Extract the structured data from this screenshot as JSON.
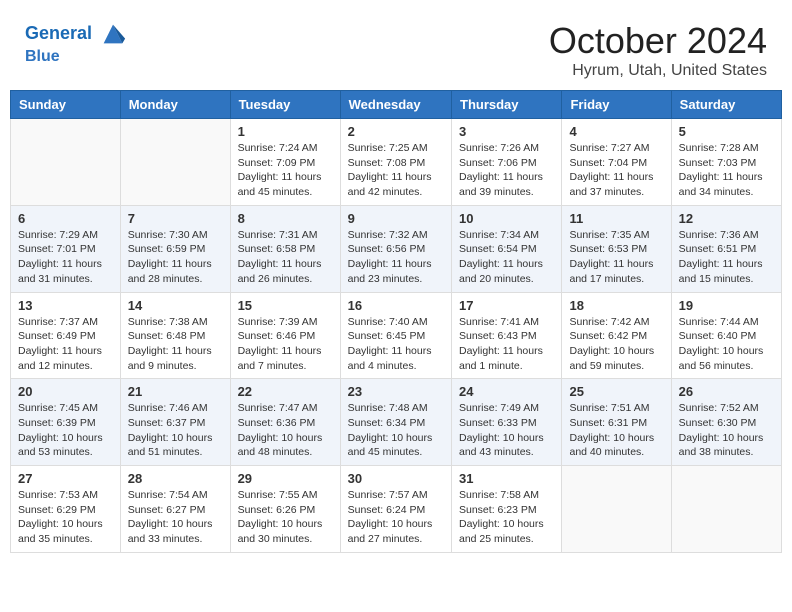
{
  "header": {
    "logo_line1": "General",
    "logo_line2": "Blue",
    "month": "October 2024",
    "location": "Hyrum, Utah, United States"
  },
  "days_of_week": [
    "Sunday",
    "Monday",
    "Tuesday",
    "Wednesday",
    "Thursday",
    "Friday",
    "Saturday"
  ],
  "weeks": [
    [
      {
        "day": "",
        "info": ""
      },
      {
        "day": "",
        "info": ""
      },
      {
        "day": "1",
        "sunrise": "Sunrise: 7:24 AM",
        "sunset": "Sunset: 7:09 PM",
        "daylight": "Daylight: 11 hours and 45 minutes."
      },
      {
        "day": "2",
        "sunrise": "Sunrise: 7:25 AM",
        "sunset": "Sunset: 7:08 PM",
        "daylight": "Daylight: 11 hours and 42 minutes."
      },
      {
        "day": "3",
        "sunrise": "Sunrise: 7:26 AM",
        "sunset": "Sunset: 7:06 PM",
        "daylight": "Daylight: 11 hours and 39 minutes."
      },
      {
        "day": "4",
        "sunrise": "Sunrise: 7:27 AM",
        "sunset": "Sunset: 7:04 PM",
        "daylight": "Daylight: 11 hours and 37 minutes."
      },
      {
        "day": "5",
        "sunrise": "Sunrise: 7:28 AM",
        "sunset": "Sunset: 7:03 PM",
        "daylight": "Daylight: 11 hours and 34 minutes."
      }
    ],
    [
      {
        "day": "6",
        "sunrise": "Sunrise: 7:29 AM",
        "sunset": "Sunset: 7:01 PM",
        "daylight": "Daylight: 11 hours and 31 minutes."
      },
      {
        "day": "7",
        "sunrise": "Sunrise: 7:30 AM",
        "sunset": "Sunset: 6:59 PM",
        "daylight": "Daylight: 11 hours and 28 minutes."
      },
      {
        "day": "8",
        "sunrise": "Sunrise: 7:31 AM",
        "sunset": "Sunset: 6:58 PM",
        "daylight": "Daylight: 11 hours and 26 minutes."
      },
      {
        "day": "9",
        "sunrise": "Sunrise: 7:32 AM",
        "sunset": "Sunset: 6:56 PM",
        "daylight": "Daylight: 11 hours and 23 minutes."
      },
      {
        "day": "10",
        "sunrise": "Sunrise: 7:34 AM",
        "sunset": "Sunset: 6:54 PM",
        "daylight": "Daylight: 11 hours and 20 minutes."
      },
      {
        "day": "11",
        "sunrise": "Sunrise: 7:35 AM",
        "sunset": "Sunset: 6:53 PM",
        "daylight": "Daylight: 11 hours and 17 minutes."
      },
      {
        "day": "12",
        "sunrise": "Sunrise: 7:36 AM",
        "sunset": "Sunset: 6:51 PM",
        "daylight": "Daylight: 11 hours and 15 minutes."
      }
    ],
    [
      {
        "day": "13",
        "sunrise": "Sunrise: 7:37 AM",
        "sunset": "Sunset: 6:49 PM",
        "daylight": "Daylight: 11 hours and 12 minutes."
      },
      {
        "day": "14",
        "sunrise": "Sunrise: 7:38 AM",
        "sunset": "Sunset: 6:48 PM",
        "daylight": "Daylight: 11 hours and 9 minutes."
      },
      {
        "day": "15",
        "sunrise": "Sunrise: 7:39 AM",
        "sunset": "Sunset: 6:46 PM",
        "daylight": "Daylight: 11 hours and 7 minutes."
      },
      {
        "day": "16",
        "sunrise": "Sunrise: 7:40 AM",
        "sunset": "Sunset: 6:45 PM",
        "daylight": "Daylight: 11 hours and 4 minutes."
      },
      {
        "day": "17",
        "sunrise": "Sunrise: 7:41 AM",
        "sunset": "Sunset: 6:43 PM",
        "daylight": "Daylight: 11 hours and 1 minute."
      },
      {
        "day": "18",
        "sunrise": "Sunrise: 7:42 AM",
        "sunset": "Sunset: 6:42 PM",
        "daylight": "Daylight: 10 hours and 59 minutes."
      },
      {
        "day": "19",
        "sunrise": "Sunrise: 7:44 AM",
        "sunset": "Sunset: 6:40 PM",
        "daylight": "Daylight: 10 hours and 56 minutes."
      }
    ],
    [
      {
        "day": "20",
        "sunrise": "Sunrise: 7:45 AM",
        "sunset": "Sunset: 6:39 PM",
        "daylight": "Daylight: 10 hours and 53 minutes."
      },
      {
        "day": "21",
        "sunrise": "Sunrise: 7:46 AM",
        "sunset": "Sunset: 6:37 PM",
        "daylight": "Daylight: 10 hours and 51 minutes."
      },
      {
        "day": "22",
        "sunrise": "Sunrise: 7:47 AM",
        "sunset": "Sunset: 6:36 PM",
        "daylight": "Daylight: 10 hours and 48 minutes."
      },
      {
        "day": "23",
        "sunrise": "Sunrise: 7:48 AM",
        "sunset": "Sunset: 6:34 PM",
        "daylight": "Daylight: 10 hours and 45 minutes."
      },
      {
        "day": "24",
        "sunrise": "Sunrise: 7:49 AM",
        "sunset": "Sunset: 6:33 PM",
        "daylight": "Daylight: 10 hours and 43 minutes."
      },
      {
        "day": "25",
        "sunrise": "Sunrise: 7:51 AM",
        "sunset": "Sunset: 6:31 PM",
        "daylight": "Daylight: 10 hours and 40 minutes."
      },
      {
        "day": "26",
        "sunrise": "Sunrise: 7:52 AM",
        "sunset": "Sunset: 6:30 PM",
        "daylight": "Daylight: 10 hours and 38 minutes."
      }
    ],
    [
      {
        "day": "27",
        "sunrise": "Sunrise: 7:53 AM",
        "sunset": "Sunset: 6:29 PM",
        "daylight": "Daylight: 10 hours and 35 minutes."
      },
      {
        "day": "28",
        "sunrise": "Sunrise: 7:54 AM",
        "sunset": "Sunset: 6:27 PM",
        "daylight": "Daylight: 10 hours and 33 minutes."
      },
      {
        "day": "29",
        "sunrise": "Sunrise: 7:55 AM",
        "sunset": "Sunset: 6:26 PM",
        "daylight": "Daylight: 10 hours and 30 minutes."
      },
      {
        "day": "30",
        "sunrise": "Sunrise: 7:57 AM",
        "sunset": "Sunset: 6:24 PM",
        "daylight": "Daylight: 10 hours and 27 minutes."
      },
      {
        "day": "31",
        "sunrise": "Sunrise: 7:58 AM",
        "sunset": "Sunset: 6:23 PM",
        "daylight": "Daylight: 10 hours and 25 minutes."
      },
      {
        "day": "",
        "info": ""
      },
      {
        "day": "",
        "info": ""
      }
    ]
  ]
}
